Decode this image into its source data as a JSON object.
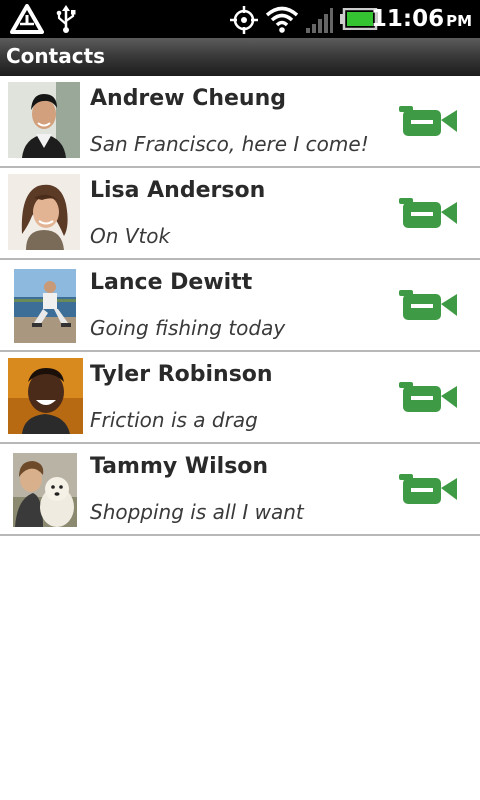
{
  "status_bar": {
    "time": "11:06",
    "ampm": "PM",
    "icons": [
      "alert-icon",
      "usb-icon",
      "gps-icon",
      "wifi-icon",
      "signal-icon",
      "battery-icon"
    ]
  },
  "header": {
    "title": "Contacts"
  },
  "colors": {
    "accent": "#3f9a45",
    "divider": "#b8b8b8"
  },
  "contacts": [
    {
      "name": "Andrew Cheung",
      "status": "San Francisco, here I come!",
      "video_icon": "video-camera-icon"
    },
    {
      "name": "Lisa Anderson",
      "status": "On Vtok",
      "video_icon": "video-camera-icon"
    },
    {
      "name": "Lance Dewitt",
      "status": "Going fishing today",
      "video_icon": "video-camera-icon"
    },
    {
      "name": "Tyler Robinson",
      "status": "Friction is a drag",
      "video_icon": "video-camera-icon"
    },
    {
      "name": "Tammy Wilson",
      "status": "Shopping is all I want",
      "video_icon": "video-camera-icon"
    }
  ]
}
